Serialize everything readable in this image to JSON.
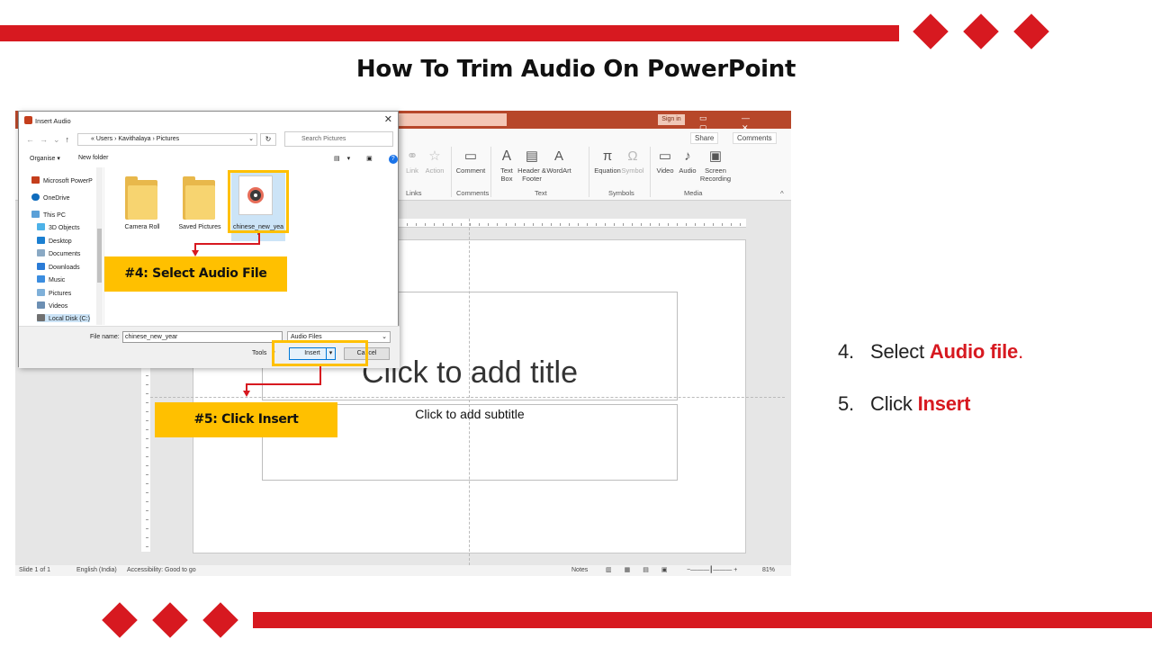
{
  "slide": {
    "title": "How To Trim Audio On PowerPoint",
    "colors": {
      "accent_red": "#d71920",
      "highlight_gold": "#ffc000"
    }
  },
  "powerpoint": {
    "sign_in": "Sign in",
    "share": "Share",
    "comments": "Comments",
    "ribbon_items": [
      {
        "label": "Link",
        "icon": "link-icon"
      },
      {
        "label": "Action",
        "icon": "action-icon"
      },
      {
        "label": "Comment",
        "icon": "comment-icon"
      },
      {
        "label": "Text Box",
        "icon": "text-box-icon"
      },
      {
        "label": "Header & Footer",
        "icon": "header-footer-icon"
      },
      {
        "label": "WordArt",
        "icon": "wordart-icon"
      },
      {
        "label": "Equation",
        "icon": "equation-icon"
      },
      {
        "label": "Symbol",
        "icon": "symbol-icon"
      },
      {
        "label": "Video",
        "icon": "video-icon"
      },
      {
        "label": "Audio",
        "icon": "audio-icon"
      },
      {
        "label": "Screen Recording",
        "icon": "screen-recording-icon"
      }
    ],
    "ribbon_groups": [
      "Links",
      "Comments",
      "Text",
      "Symbols",
      "Media"
    ],
    "title_placeholder": "Click to add title",
    "subtitle_placeholder": "Click to add subtitle",
    "status": {
      "slide": "Slide 1 of 1",
      "language": "English (India)",
      "accessibility": "Accessibility: Good to go",
      "notes": "Notes",
      "zoom": "81%"
    }
  },
  "dialog": {
    "title": "Insert Audio",
    "path": [
      "Users",
      "Kavithalaya",
      "Pictures"
    ],
    "search_placeholder": "Search Pictures",
    "organise": "Organise",
    "new_folder": "New folder",
    "sidebar": [
      "Microsoft PowerP",
      "OneDrive",
      "This PC",
      "3D Objects",
      "Desktop",
      "Documents",
      "Downloads",
      "Music",
      "Pictures",
      "Videos",
      "Local Disk (C:)"
    ],
    "folders": [
      "Camera Roll",
      "Saved Pictures"
    ],
    "audio_file": "chinese_new_yea r",
    "file_name_label": "File name:",
    "file_name_value": "chinese_new_year",
    "file_type": "Audio Files",
    "tools": "Tools",
    "insert": "Insert",
    "cancel": "Cancel"
  },
  "callouts": {
    "select_audio": "#4: Select Audio File",
    "click_insert": "#5: Click Insert"
  },
  "steps": [
    {
      "num": "4.",
      "prefix": "Select ",
      "emphasis": "Audio file",
      "suffix": "."
    },
    {
      "num": "5.",
      "prefix": "Click ",
      "emphasis": "Insert",
      "suffix": ""
    }
  ]
}
